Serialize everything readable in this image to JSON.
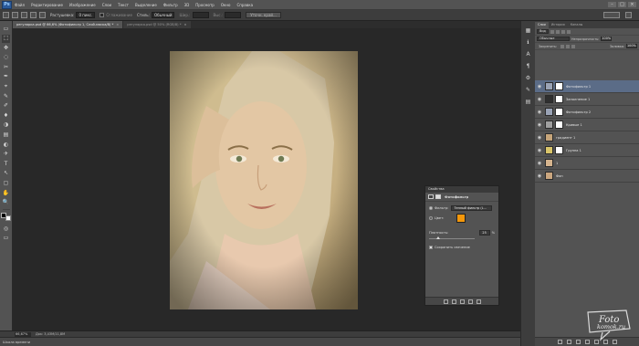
{
  "menu": {
    "logo": "Ps",
    "items": [
      "Файл",
      "Редактирование",
      "Изображение",
      "Слои",
      "Текст",
      "Выделение",
      "Фильтр",
      "3D",
      "Просмотр",
      "Окно",
      "Справка"
    ]
  },
  "options": {
    "feather_label": "Растушевка:",
    "feather_value": "0 пикс.",
    "antialias_label": "Сглаживание",
    "style_label": "Стиль:",
    "style_value": "Обычный",
    "width_label": "Шир.:",
    "height_label": "Выс.:",
    "refine_button": "Уточн. край..."
  },
  "tabs": [
    {
      "label": "регулярка.psd @ 66,6% (Фотофильтр 1, Слой-маска/8) *",
      "close": "×"
    },
    {
      "label": "регулярка.psd @ 50% (RGB/8) *",
      "close": "×"
    }
  ],
  "toolbar": {
    "tools": [
      "▭",
      "⬚",
      "✥",
      "◌",
      "✂",
      "✒",
      "⌖",
      "✎",
      "✐",
      "♦",
      "◑",
      "▤",
      "◐",
      "✈",
      "T",
      "↖",
      "▢",
      "✋",
      "🔍"
    ]
  },
  "status": {
    "zoom": "66,67%",
    "doc_info": "Док: 3,43М/11,8М",
    "timeline": "Шкала времени"
  },
  "dock": {
    "icons": [
      "▦",
      "ℹ",
      "A",
      "¶",
      "⚙",
      "✎",
      "▤"
    ]
  },
  "layers": {
    "tabs": [
      "Слои",
      "История",
      "Каналы"
    ],
    "filter_label": "Вид",
    "blend_mode": "Обычные",
    "opacity_label": "Непрозрачность:",
    "opacity_value": "100%",
    "lock_label": "Закрепить:",
    "fill_label": "Заливка:",
    "fill_value": "100%",
    "items": [
      {
        "name": "Фотофильтр 1",
        "thumb": "#9aa3b5",
        "mask": true,
        "selected": true
      },
      {
        "name": "Заполнение 1",
        "thumb": "#2f2f2f",
        "mask": true,
        "selected": false
      },
      {
        "name": "Фотофильтр 2",
        "thumb": "#9aa3b5",
        "mask": true,
        "selected": false
      },
      {
        "name": "Кривые 1",
        "thumb": "#a0a0a0",
        "mask": true,
        "selected": false
      },
      {
        "name": "градиент 1",
        "thumb": "#c6a57a",
        "mask": false,
        "selected": false
      },
      {
        "name": "Группа 1",
        "thumb": "#d9c56a",
        "mask": true,
        "selected": false
      },
      {
        "name": "1",
        "thumb": "#d5b48e",
        "mask": false,
        "selected": false
      },
      {
        "name": "Фон",
        "thumb": "#caa67f",
        "mask": false,
        "selected": false
      }
    ]
  },
  "properties": {
    "title": "Свойства",
    "adjustment": "Фотофильтр",
    "filter_label": "Фильтр:",
    "filter_value": "Теплый фильтр (L...",
    "color_label": "Цвет:",
    "color_hex": "#f3970b",
    "density_label": "Плотность:",
    "density_value": "25",
    "density_unit": "%",
    "preserve_label": "Сохранить свечение"
  },
  "watermark": {
    "line1": "Foto",
    "line2": "komok.ru"
  }
}
